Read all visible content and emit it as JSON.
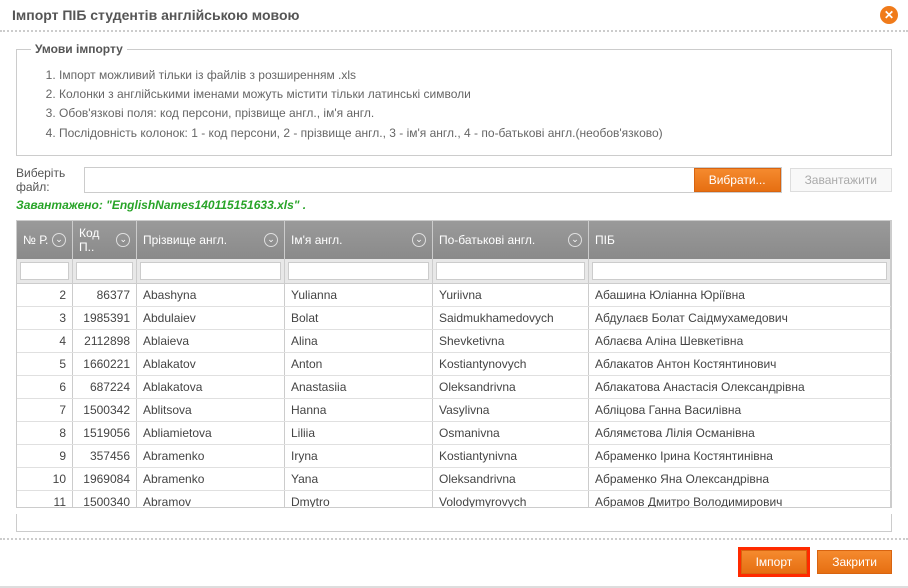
{
  "dialog": {
    "title": "Імпорт ПІБ студентів англійською мовою"
  },
  "conditions": {
    "legend": "Умови імпорту",
    "items": [
      "Імпорт можливий тільки із файлів з розширенням .xls",
      "Колонки з англійськими іменами можуть містити тільки латинські символи",
      "Обов'язкові поля: код персони, прізвище англ., ім'я англ.",
      "Послідовність колонок: 1 - код персони, 2 - прізвище англ., 3 - ім'я англ., 4 - по-батькові англ.(необов'язково)"
    ]
  },
  "file": {
    "label": "Виберіть файл:",
    "browse": "Вибрати...",
    "upload": "Завантажити",
    "loaded": "Завантажено: \"EnglishNames140115151633.xls\" ."
  },
  "columns": {
    "idx": "№ Р.",
    "code": "Код П..",
    "surname": "Прізвище англ.",
    "name": "Ім'я англ.",
    "patronymic": "По-батькові англ.",
    "pib": "ПІБ"
  },
  "rows": [
    {
      "idx": "2",
      "code": "86377",
      "surname": "Abashyna",
      "name": "Yulianna",
      "patronymic": "Yuriivna",
      "pib": "Абашина Юліанна Юріївна"
    },
    {
      "idx": "3",
      "code": "1985391",
      "surname": "Abdulaiev",
      "name": "Bolat",
      "patronymic": "Saidmukhamedovych",
      "pib": "Абдулаєв Болат Саідмухамедович"
    },
    {
      "idx": "4",
      "code": "2112898",
      "surname": "Ablaieva",
      "name": "Alina",
      "patronymic": "Shevketivna",
      "pib": "Аблаєва Аліна Шевкетівна"
    },
    {
      "idx": "5",
      "code": "1660221",
      "surname": "Ablakatov",
      "name": "Anton",
      "patronymic": "Kostiantynovych",
      "pib": "Аблакатов Антон Костянтинович"
    },
    {
      "idx": "6",
      "code": "687224",
      "surname": "Ablakatova",
      "name": "Anastasiia",
      "patronymic": "Oleksandrivna",
      "pib": "Аблакатова Анастасія Олександрівна"
    },
    {
      "idx": "7",
      "code": "1500342",
      "surname": "Ablitsova",
      "name": "Hanna",
      "patronymic": "Vasylivna",
      "pib": "Абліцова Ганна Василівна"
    },
    {
      "idx": "8",
      "code": "1519056",
      "surname": "Abliamietova",
      "name": "Liliia",
      "patronymic": "Osmanivna",
      "pib": "Аблямєтова Лілія Османівна"
    },
    {
      "idx": "9",
      "code": "357456",
      "surname": "Abramenko",
      "name": "Iryna",
      "patronymic": "Kostiantynivna",
      "pib": "Абраменко Ірина Костянтинівна"
    },
    {
      "idx": "10",
      "code": "1969084",
      "surname": "Abramenko",
      "name": "Yana",
      "patronymic": "Oleksandrivna",
      "pib": "Абраменко Яна Олександрівна"
    },
    {
      "idx": "11",
      "code": "1500340",
      "surname": "Abramov",
      "name": "Dmytro",
      "patronymic": "Volodymyrovych",
      "pib": "Абрамов Дмитро Володимирович"
    }
  ],
  "footer": {
    "import": "Імпорт",
    "close": "Закрити"
  }
}
